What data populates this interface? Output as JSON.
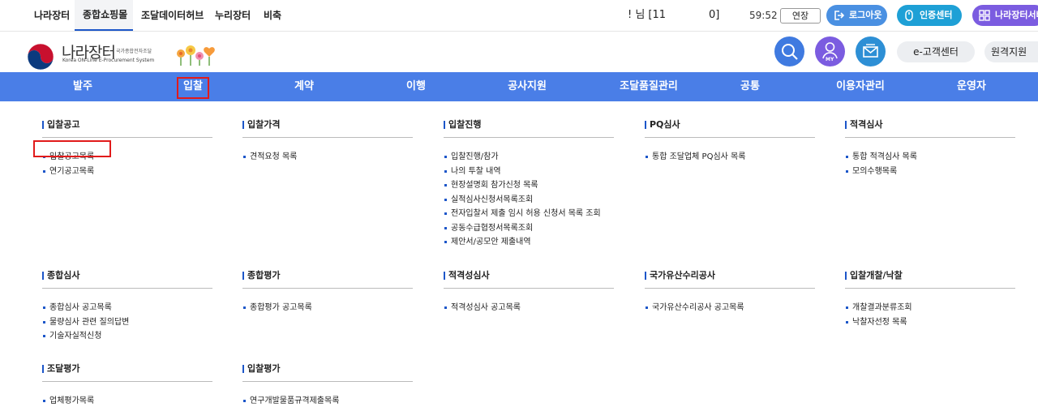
{
  "topbar": {
    "tabs": [
      "나라장터",
      "종합쇼핑몰",
      "조달데이터허브",
      "누리장터",
      "비축"
    ],
    "active_tab": "종합쇼핑몰",
    "user_prefix": "! 님 [11",
    "user_suffix": "0]",
    "timer": "59:52",
    "extend_label": "연장",
    "logout_label": "로그아웃",
    "cert_label": "인증센터",
    "naraserver_label": "나라장터서버"
  },
  "header": {
    "logo_ko": "나라장터",
    "logo_sub": "국가종합전자조달",
    "logo_en": "Korea ON-Line E-Procurement System",
    "my_label": "MY",
    "customer_center_label": "e-고객센터",
    "remote_support_label": "원격지원"
  },
  "mainnav": {
    "items": [
      "발주",
      "입찰",
      "계약",
      "이행",
      "공사지원",
      "조달품질관리",
      "공통",
      "이용자관리",
      "운영자"
    ],
    "active": "입찰"
  },
  "menu": {
    "sections": [
      {
        "title": "입찰공고",
        "items": [
          "입찰공고목록",
          "연기공고목록"
        ]
      },
      {
        "title": "입찰가격",
        "items": [
          "견적요청 목록"
        ]
      },
      {
        "title": "입찰진행",
        "items": [
          "입찰진행/참가",
          "나의 투찰 내역",
          "현장설명회 참가신청 목록",
          "실적심사신청서목록조회",
          "전자입찰서 제출 임시 허용 신청서 목록 조회",
          "공동수급협정서목록조회",
          "제안서/공모안 제출내역"
        ]
      },
      {
        "title": "PQ심사",
        "items": [
          "통합 조달업체 PQ심사 목록"
        ]
      },
      {
        "title": "적격심사",
        "items": [
          "통합 적격심사 목록",
          "모의수행목록"
        ]
      },
      {
        "title": "종합심사",
        "items": [
          "종합심사 공고목록",
          "물량심사 관련 질의답변",
          "기술자실적신청"
        ]
      },
      {
        "title": "종합평가",
        "items": [
          "종합평가 공고목록"
        ]
      },
      {
        "title": "적격성심사",
        "items": [
          "적격성심사 공고목록"
        ]
      },
      {
        "title": "국가유산수리공사",
        "items": [
          "국가유산수리공사 공고목록"
        ]
      },
      {
        "title": "입찰개찰/낙찰",
        "items": [
          "개찰결과분류조회",
          "낙찰자선정 목록"
        ]
      },
      {
        "title": "조달평가",
        "items": [
          "업체평가목록"
        ]
      },
      {
        "title": "입찰평가",
        "items": [
          "연구개발물품규격제출목록"
        ]
      }
    ]
  },
  "colors": {
    "nav_blue": "#4a7ee7",
    "pill_blue": "#4a90e2",
    "pill_cyan": "#1ea0d6",
    "pill_purple": "#7b5ce0",
    "highlight_red": "#e11b1b",
    "bullet_blue": "#1c56c9"
  }
}
